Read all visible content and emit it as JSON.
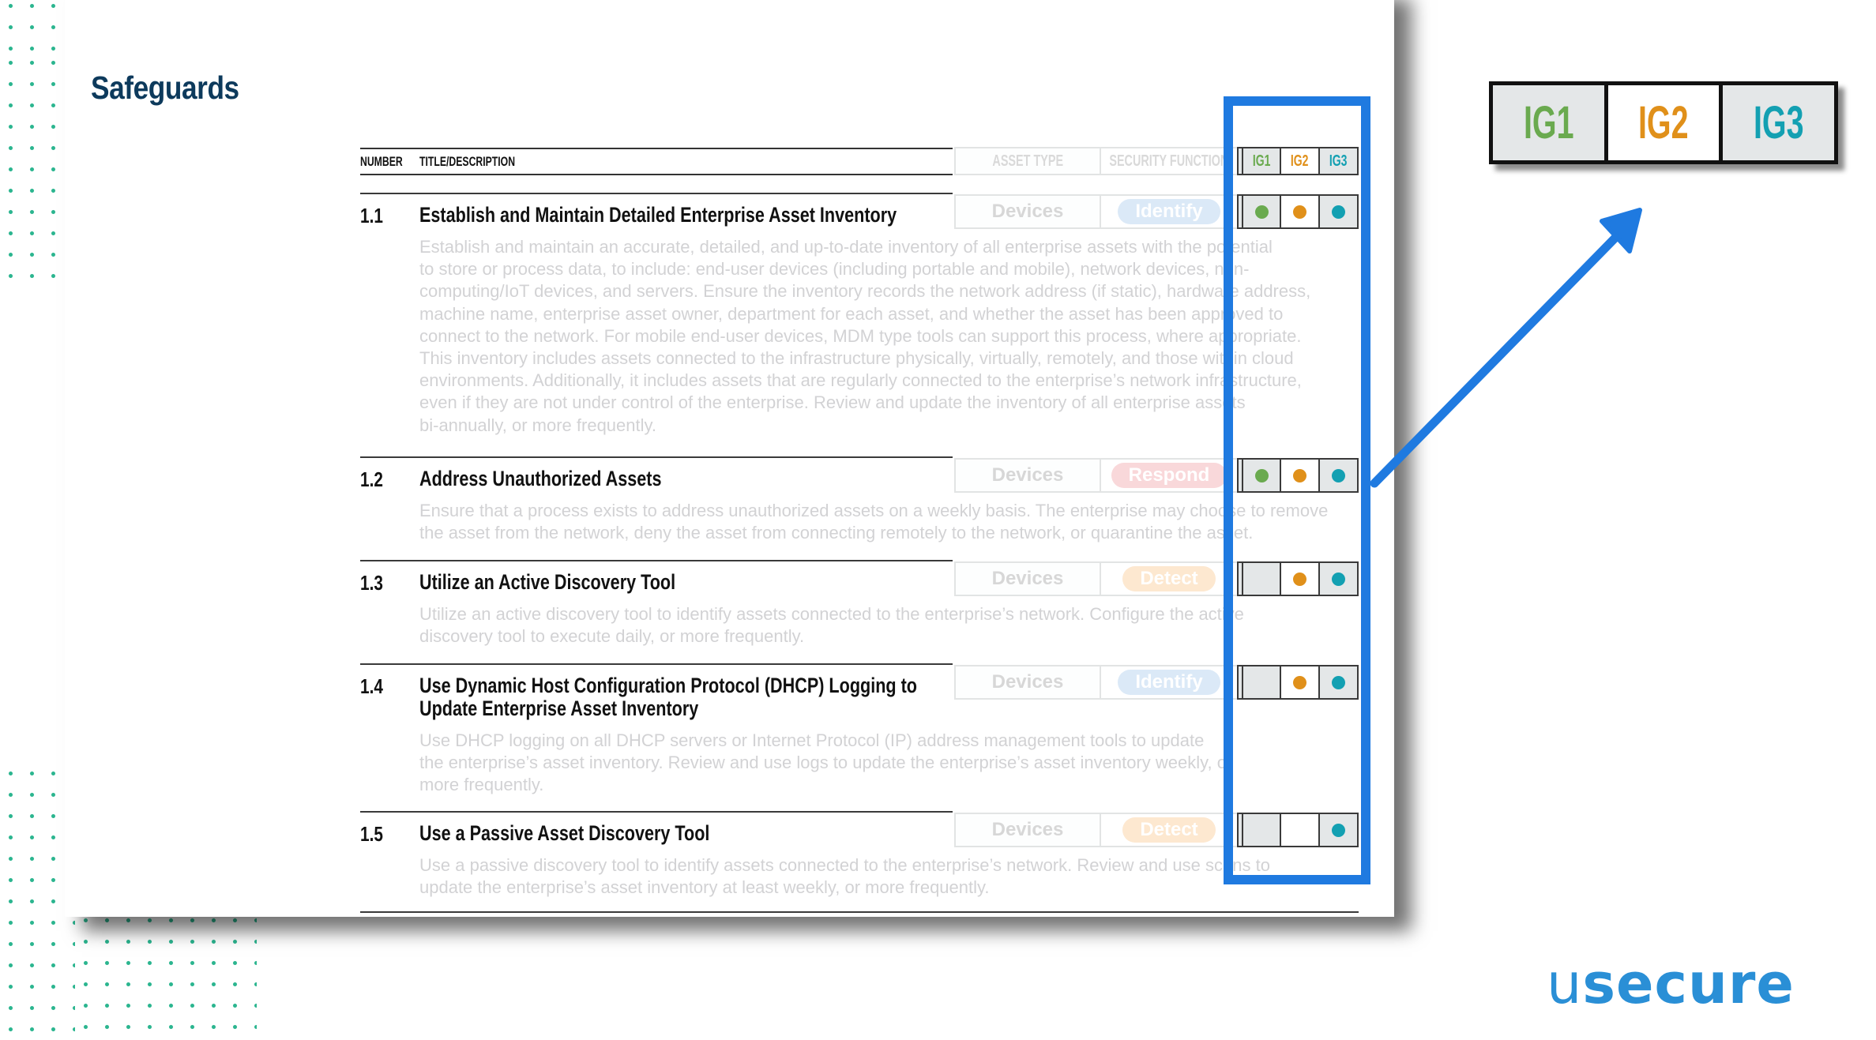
{
  "page": {
    "title": "Safeguards"
  },
  "table_header": {
    "number": "NUMBER",
    "title_description": "TITLE/DESCRIPTION",
    "asset_type": "ASSET TYPE",
    "security_function": "SECURITY FUNCTION",
    "ig_labels": [
      "IG1",
      "IG2",
      "IG3"
    ]
  },
  "colors": {
    "ig1": "#6aaa4f",
    "ig2": "#e0901a",
    "ig3": "#13a0b2",
    "frame_blue": "#1f7ae0",
    "title_navy": "#0d3a5c",
    "dots_green": "#2bb58f",
    "logo_blue": "#2a8fd6",
    "identify": "#dbe9f7",
    "respond": "#f9d8da",
    "detect": "#fde8d0"
  },
  "safeguards": [
    {
      "number": "1.1",
      "title": [
        "Establish and Maintain Detailed Enterprise Asset Inventory"
      ],
      "description": [
        "Establish and maintain an accurate, detailed, and up-to-date inventory of all enterprise assets with the potential",
        "to store or process data, to include: end-user devices (including portable and mobile), network devices, non-",
        "computing/IoT devices, and servers. Ensure the inventory records the network address (if static), hardware address,",
        "machine name, enterprise asset owner, department for each asset, and whether the asset has been approved to",
        "connect to the network. For mobile end-user devices, MDM type tools can support this process, where appropriate.",
        "This inventory includes assets connected to the infrastructure physically, virtually, remotely, and those within cloud",
        "environments. Additionally, it includes assets that are regularly connected to the enterprise’s network infrastructure,",
        "even if they are not under control of the enterprise. Review and update the inventory of all enterprise assets",
        "bi-annually, or more frequently."
      ],
      "asset_type": "Devices",
      "security_function": "Identify",
      "ig": [
        true,
        true,
        true
      ]
    },
    {
      "number": "1.2",
      "title": [
        "Address Unauthorized Assets"
      ],
      "description": [
        "Ensure that a process exists to address unauthorized assets on a weekly basis. The enterprise may choose to remove",
        "the asset from the network, deny the asset from connecting remotely to the network, or quarantine the asset."
      ],
      "asset_type": "Devices",
      "security_function": "Respond",
      "ig": [
        true,
        true,
        true
      ]
    },
    {
      "number": "1.3",
      "title": [
        "Utilize an Active Discovery Tool"
      ],
      "description": [
        "Utilize an active discovery tool to identify assets connected to the enterprise’s network. Configure the active",
        "discovery tool to execute daily, or more frequently."
      ],
      "asset_type": "Devices",
      "security_function": "Detect",
      "ig": [
        false,
        true,
        true
      ]
    },
    {
      "number": "1.4",
      "title": [
        "Use Dynamic Host Configuration Protocol (DHCP) Logging to",
        "Update Enterprise Asset Inventory"
      ],
      "description": [
        "Use DHCP logging on all DHCP servers or Internet Protocol (IP) address management tools to update",
        "the enterprise’s asset inventory. Review and use logs to update the enterprise’s asset inventory weekly, or",
        "more frequently."
      ],
      "asset_type": "Devices",
      "security_function": "Identify",
      "ig": [
        false,
        true,
        true
      ]
    },
    {
      "number": "1.5",
      "title": [
        "Use a Passive Asset Discovery Tool"
      ],
      "description": [
        "Use a passive discovery tool to identify assets connected to the enterprise’s network. Review and use scans to",
        "update the enterprise’s asset inventory at least weekly, or more frequently."
      ],
      "asset_type": "Devices",
      "security_function": "Detect",
      "ig": [
        false,
        false,
        true
      ]
    }
  ],
  "callout": {
    "labels": [
      "IG1",
      "IG2",
      "IG3"
    ]
  },
  "logo": {
    "light": "u",
    "bold": "secure"
  },
  "icons": {
    "arrow": "arrow-up-right-icon",
    "ig_marker": "filled-circle-icon"
  }
}
